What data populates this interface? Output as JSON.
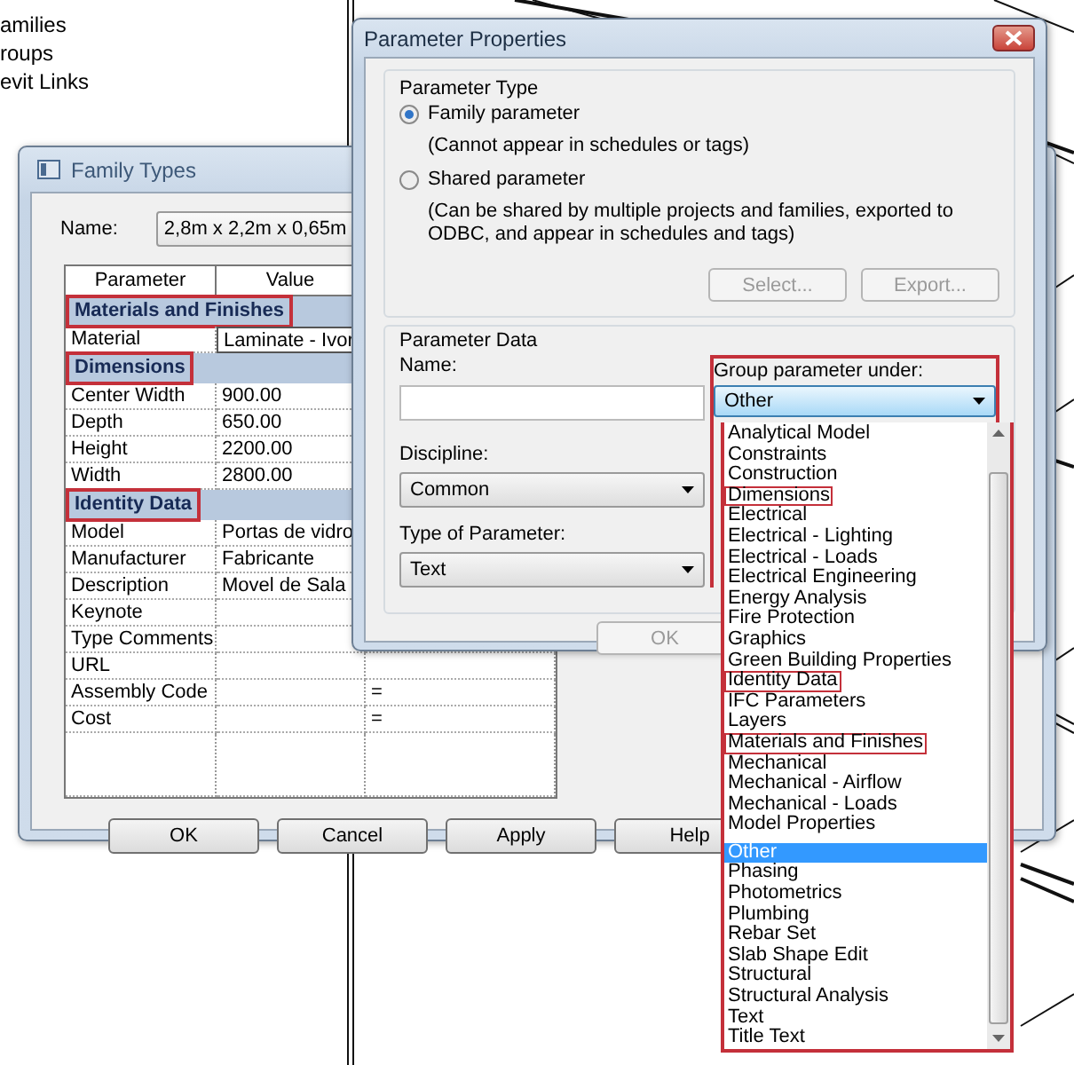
{
  "tree": {
    "items": [
      "amilies",
      "roups",
      "evit Links"
    ]
  },
  "family_types": {
    "title": "Family Types",
    "name_label": "Name:",
    "name_value": "2,8m x 2,2m x 0,65m",
    "columns": [
      "Parameter",
      "Value"
    ],
    "rows": [
      {
        "kind": "group",
        "label": "Materials and Finishes",
        "highlighted": true
      },
      {
        "kind": "param",
        "parameter": "Material",
        "value": "Laminate - Ivor"
      },
      {
        "kind": "group",
        "label": "Dimensions",
        "highlighted": true
      },
      {
        "kind": "param",
        "parameter": "Center Width",
        "value": "900.00"
      },
      {
        "kind": "param",
        "parameter": "Depth",
        "value": "650.00"
      },
      {
        "kind": "param",
        "parameter": "Height",
        "value": "2200.00"
      },
      {
        "kind": "param",
        "parameter": "Width",
        "value": "2800.00"
      },
      {
        "kind": "group",
        "label": "Identity Data",
        "highlighted": true
      },
      {
        "kind": "param",
        "parameter": "Model",
        "value": "Portas de vidro"
      },
      {
        "kind": "param",
        "parameter": "Manufacturer",
        "value": "Fabricante"
      },
      {
        "kind": "param",
        "parameter": "Description",
        "value": "Movel de Sala"
      },
      {
        "kind": "param",
        "parameter": "Keynote"
      },
      {
        "kind": "param",
        "parameter": "Type Comments"
      },
      {
        "kind": "param",
        "parameter": "URL"
      },
      {
        "kind": "param",
        "parameter": "Assembly Code",
        "column_3": "="
      },
      {
        "kind": "param",
        "parameter": "Cost",
        "column_3": "="
      },
      {
        "kind": "blank"
      }
    ],
    "buttons": [
      "OK",
      "Cancel",
      "Apply",
      "Help"
    ]
  },
  "parameter_properties": {
    "title": "Parameter Properties",
    "parameter_type": {
      "legend": "Parameter Type",
      "options": [
        {
          "label": "Family parameter",
          "note": "(Cannot appear in schedules or tags)",
          "selected": true
        },
        {
          "label": "Shared parameter",
          "note": "(Can be shared by multiple projects and families, exported to ODBC, and appear in schedules and tags)",
          "selected": false
        }
      ],
      "buttons": [
        {
          "label": "Select...",
          "disabled": true
        },
        {
          "label": "Export...",
          "disabled": true
        }
      ]
    },
    "parameter_data": {
      "legend": "Parameter Data",
      "name_label": "Name:",
      "discipline_label": "Discipline:",
      "discipline": "Common",
      "type_label": "Type of Parameter:",
      "type": "Text",
      "group_label": "Group parameter under:",
      "group": "Other",
      "group_highlighted": true
    },
    "ok_button": {
      "label": "OK",
      "disabled": true
    }
  },
  "group_list": {
    "items": [
      {
        "label": "Analytical Model",
        "selected": false,
        "highlighted": false
      },
      {
        "label": "Constraints",
        "selected": false,
        "highlighted": false
      },
      {
        "label": "Construction",
        "selected": false,
        "highlighted": false
      },
      {
        "label": "Dimensions",
        "selected": false,
        "highlighted": true
      },
      {
        "label": "Electrical",
        "selected": false,
        "highlighted": false
      },
      {
        "label": "Electrical - Lighting",
        "selected": false,
        "highlighted": false
      },
      {
        "label": "Electrical - Loads",
        "selected": false,
        "highlighted": false
      },
      {
        "label": "Electrical Engineering",
        "selected": false,
        "highlighted": false
      },
      {
        "label": "Energy Analysis",
        "selected": false,
        "highlighted": false
      },
      {
        "label": "Fire Protection",
        "selected": false,
        "highlighted": false
      },
      {
        "label": "Graphics",
        "selected": false,
        "highlighted": false
      },
      {
        "label": "Green Building Properties",
        "selected": false,
        "highlighted": false
      },
      {
        "label": "Identity Data",
        "selected": false,
        "highlighted": true
      },
      {
        "label": "IFC Parameters",
        "selected": false,
        "highlighted": false
      },
      {
        "label": "Layers",
        "selected": false,
        "highlighted": false
      },
      {
        "label": "Materials and Finishes",
        "selected": false,
        "highlighted": true
      },
      {
        "label": "Mechanical",
        "selected": false,
        "highlighted": false
      },
      {
        "label": "Mechanical - Airflow",
        "selected": false,
        "highlighted": false
      },
      {
        "label": "Mechanical - Loads",
        "selected": false,
        "highlighted": false
      },
      {
        "label": "Model Properties",
        "selected": false,
        "highlighted": false
      },
      {
        "label": "Other",
        "selected": true,
        "highlighted": false
      },
      {
        "label": "Phasing",
        "selected": false,
        "highlighted": false
      },
      {
        "label": "Photometrics",
        "selected": false,
        "highlighted": false
      },
      {
        "label": "Plumbing",
        "selected": false,
        "highlighted": false
      },
      {
        "label": "Rebar Set",
        "selected": false,
        "highlighted": false
      },
      {
        "label": "Slab Shape Edit",
        "selected": false,
        "highlighted": false
      },
      {
        "label": "Structural",
        "selected": false,
        "highlighted": false
      },
      {
        "label": "Structural Analysis",
        "selected": false,
        "highlighted": false
      },
      {
        "label": "Text",
        "selected": false,
        "highlighted": false
      },
      {
        "label": "Title Text",
        "selected": false,
        "highlighted": false
      }
    ]
  }
}
